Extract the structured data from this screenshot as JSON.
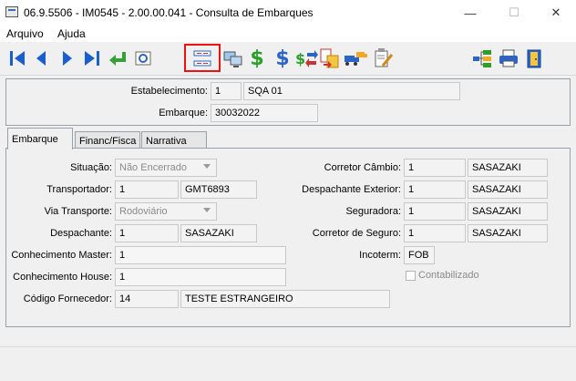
{
  "window": {
    "title": "06.9.5506 - IM0545 - 2.00.00.041 - Consulta de Embarques",
    "minimize_glyph": "—",
    "maximize_glyph": "☐",
    "close_glyph": "✕"
  },
  "menu": {
    "items": [
      "Arquivo",
      "Ajuda"
    ]
  },
  "toolbar": {
    "icons": [
      "first-record-icon",
      "previous-record-icon",
      "next-record-icon",
      "last-record-icon",
      "return-icon",
      "preview-icon",
      "list-view-icon",
      "computer-screen-icon",
      "dollar-icon",
      "dollar-outline-icon",
      "currency-exchange-icon",
      "document-transfer-icon",
      "trucks-icon",
      "edit-form-icon",
      "tree-structure-icon",
      "printer-icon",
      "exit-door-icon"
    ],
    "highlighted": "list-view-icon"
  },
  "header": {
    "estabelecimento_label": "Estabelecimento:",
    "estabelecimento_code": "1",
    "estabelecimento_name": "SQA 01",
    "embarque_label": "Embarque:",
    "embarque_value": "30032022"
  },
  "tabs": [
    {
      "label": "Embarque",
      "active": true
    },
    {
      "label": "Financ/Fisca",
      "active": false
    },
    {
      "label": "Narrativa",
      "active": false
    }
  ],
  "form": {
    "situacao_label": "Situação:",
    "situacao_value": "Não Encerrado",
    "transportador_label": "Transportador:",
    "transportador_code": "1",
    "transportador_name": "GMT6893",
    "via_transporte_label": "Via Transporte:",
    "via_transporte_value": "Rodoviário",
    "despachante_label": "Despachante:",
    "despachante_code": "1",
    "despachante_name": "SASAZAKI",
    "conhecimento_master_label": "Conhecimento Master:",
    "conhecimento_master_value": "1",
    "conhecimento_house_label": "Conhecimento House:",
    "conhecimento_house_value": "1",
    "codigo_fornecedor_label": "Código Fornecedor:",
    "codigo_fornecedor_code": "14",
    "codigo_fornecedor_name": "TESTE ESTRANGEIRO",
    "corretor_cambio_label": "Corretor Câmbio:",
    "corretor_cambio_code": "1",
    "corretor_cambio_name": "SASAZAKI",
    "despachante_exterior_label": "Despachante Exterior:",
    "despachante_exterior_code": "1",
    "despachante_exterior_name": "SASAZAKI",
    "seguradora_label": "Seguradora:",
    "seguradora_code": "1",
    "seguradora_name": "SASAZAKI",
    "corretor_seguro_label": "Corretor de Seguro:",
    "corretor_seguro_code": "1",
    "corretor_seguro_name": "SASAZAKI",
    "incoterm_label": "Incoterm:",
    "incoterm_value": "FOB",
    "contabilizado_label": "Contabilizado",
    "contabilizado_checked": false
  },
  "colors": {
    "highlight_border": "#e11111",
    "nav_blue": "#1b5fcf",
    "dollar_green": "#2aa02a",
    "dollar_blue": "#2a64c8"
  }
}
